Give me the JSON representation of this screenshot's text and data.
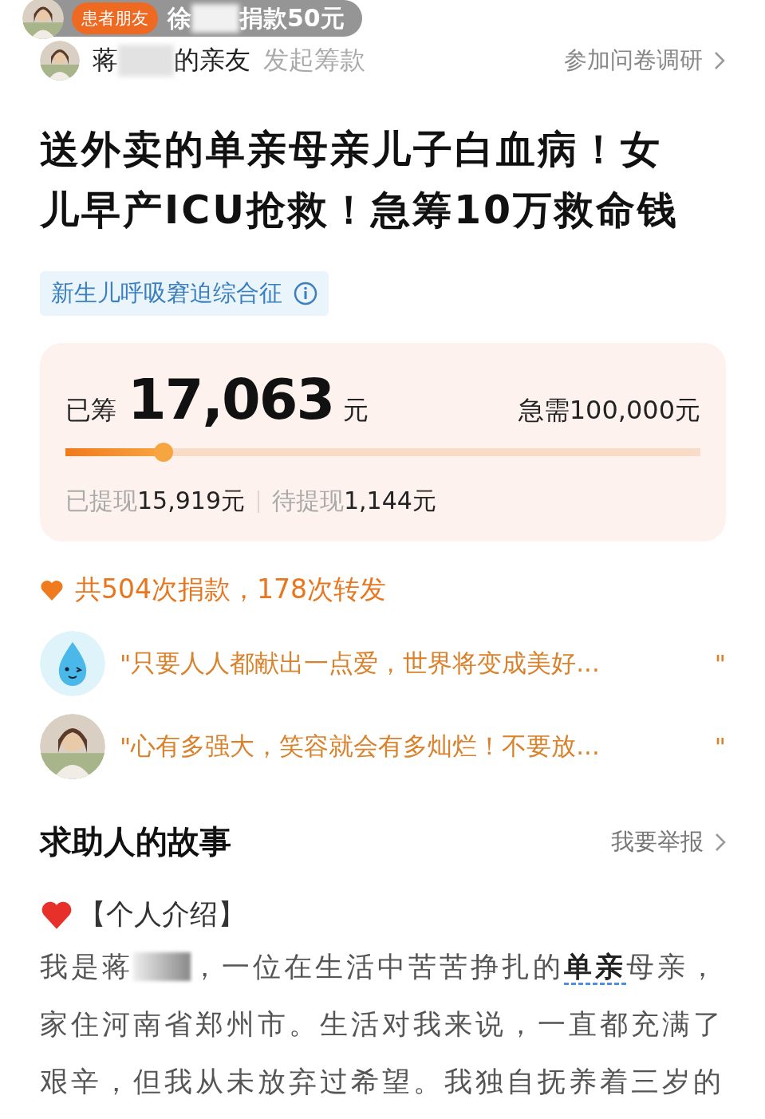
{
  "toast": {
    "badge": "患者朋友",
    "name": "徐",
    "action": "捐款50元"
  },
  "organizer": {
    "name": "蒋",
    "relation": "的亲友",
    "action": "发起筹款",
    "survey_link": "参加问卷调研"
  },
  "title": "送外卖的单亲母亲儿子白血病！女儿早产ICU抢救！急筹10万救命钱",
  "tag": "新生儿呼吸窘迫综合征",
  "funding": {
    "raised_label": "已筹",
    "raised": "17,063",
    "unit": "元",
    "target": "急需100,000元",
    "level": 0.17,
    "withdrawn_label": "已提现",
    "withdrawn": "15,919元",
    "pending_label": "待提现",
    "pending": "1,144元"
  },
  "stats": "共504次捐款，178次转发",
  "messages": [
    {
      "kind": "mascot",
      "open_quote": "\"",
      "text": "只要人人都献出一点爱，世界将变成美好...",
      "close_quote": "\""
    },
    {
      "open_quote": "\"",
      "text": "心有多强大，笑容就会有多灿烂！不要放...",
      "close_quote": "\""
    }
  ],
  "story": {
    "heading": "求助人的故事",
    "report_link": "我要举报",
    "section_label": "【个人介绍】",
    "paragraph_start": "我是蒋",
    "first_line_rest": "，一位在生活中苦苦挣扎的**单亲**母亲，",
    "paragraph_rest": "家住河南省郑州市。生活对我来说，一直都充满了艰辛，但我从未放弃过希望。我独自抚养着三岁的"
  }
}
